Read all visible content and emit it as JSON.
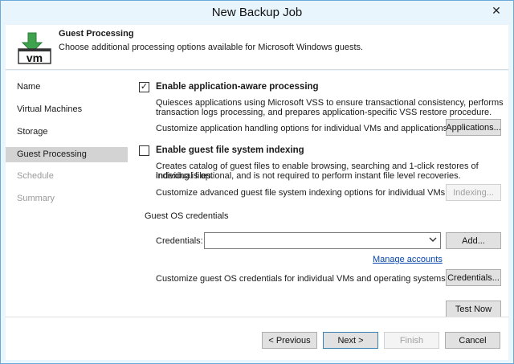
{
  "window": {
    "title": "New Backup Job",
    "close_glyph": "✕"
  },
  "header": {
    "icon": "vm-backup-icon",
    "icon_text": "vm",
    "title": "Guest Processing",
    "description": "Choose additional processing options available for Microsoft Windows guests."
  },
  "sidebar": {
    "items": [
      {
        "label": "Name",
        "state": "normal"
      },
      {
        "label": "Virtual Machines",
        "state": "normal"
      },
      {
        "label": "Storage",
        "state": "normal"
      },
      {
        "label": "Guest Processing",
        "state": "active"
      },
      {
        "label": "Schedule",
        "state": "disabled"
      },
      {
        "label": "Summary",
        "state": "disabled"
      }
    ]
  },
  "app_aware": {
    "checked": true,
    "check_glyph": "✓",
    "label": "Enable application-aware processing",
    "desc_line1": "Quiesces applications using Microsoft VSS to ensure transactional consistency, performs",
    "desc_line2": "transaction logs processing, and prepares application-specific VSS restore procedure.",
    "customize_text": "Customize application handling options for individual VMs and applications",
    "button_label": "Applications..."
  },
  "indexing": {
    "checked": false,
    "label": "Enable guest file system indexing",
    "desc_line1": "Creates catalog of guest files to enable browsing, searching and 1-click restores of individual files.",
    "desc_line2": "Indexing is optional, and is not required to perform instant file level recoveries.",
    "customize_text": "Customize advanced guest file system indexing options for individual VMs",
    "button_label": "Indexing..."
  },
  "credentials": {
    "group_label": "Guest OS credentials",
    "field_label": "Credentials:",
    "value": "",
    "add_button": "Add...",
    "manage_link": "Manage accounts",
    "customize_text": "Customize guest OS credentials for individual VMs and operating systems",
    "credentials_button": "Credentials...",
    "test_button": "Test Now"
  },
  "footer": {
    "previous": "< Previous",
    "next": "Next >",
    "finish": "Finish",
    "cancel": "Cancel"
  }
}
